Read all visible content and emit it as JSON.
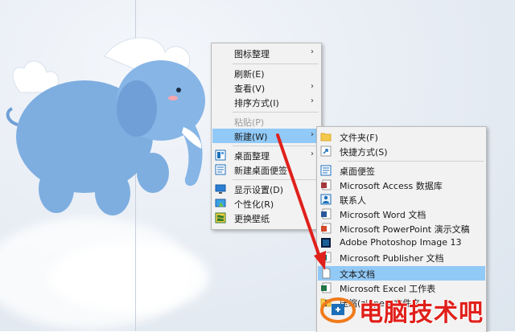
{
  "menu": {
    "items": [
      {
        "label": "图标整理",
        "submenu": true,
        "icon": "none"
      },
      {
        "label": "刷新(E)",
        "submenu": false,
        "icon": "none"
      },
      {
        "label": "查看(V)",
        "submenu": true,
        "icon": "none"
      },
      {
        "label": "排序方式(I)",
        "submenu": true,
        "icon": "none"
      },
      {
        "label": "粘贴(P)",
        "disabled": true,
        "icon": "none"
      },
      {
        "label": "新建(W)",
        "submenu": true,
        "highlighted": true,
        "icon": "none"
      },
      {
        "label": "桌面整理",
        "submenu": true,
        "icon": "desktop-organize-icon"
      },
      {
        "label": "新建桌面便签",
        "icon": "sticky-note-icon"
      },
      {
        "label": "显示设置(D)",
        "icon": "display-settings-icon"
      },
      {
        "label": "个性化(R)",
        "icon": "personalize-icon"
      },
      {
        "label": "更换壁纸",
        "icon": "wallpaper-icon"
      }
    ]
  },
  "submenu": {
    "items": [
      {
        "label": "文件夹(F)",
        "icon": "folder-icon"
      },
      {
        "label": "快捷方式(S)",
        "icon": "shortcut-icon"
      },
      {
        "label": "桌面便签",
        "icon": "note-icon"
      },
      {
        "label": "Microsoft Access 数据库",
        "icon": "access-icon"
      },
      {
        "label": "联系人",
        "icon": "contact-icon"
      },
      {
        "label": "Microsoft Word 文档",
        "icon": "word-icon"
      },
      {
        "label": "Microsoft PowerPoint 演示文稿",
        "icon": "powerpoint-icon"
      },
      {
        "label": "Adobe Photoshop Image 13",
        "icon": "photoshop-icon"
      },
      {
        "label": "Microsoft Publisher 文档",
        "icon": "publisher-icon"
      },
      {
        "label": "文本文档",
        "highlighted": true,
        "icon": "text-document-icon"
      },
      {
        "label": "Microsoft Excel 工作表",
        "icon": "excel-icon"
      },
      {
        "label": "压缩(zipped)文件夹",
        "icon": "zip-icon"
      }
    ]
  },
  "watermark": {
    "text": "电脑技术吧"
  },
  "colors": {
    "highlight": "#91c9f7",
    "arrow": "#e0201b",
    "menu_bg": "#f2f2f2"
  }
}
